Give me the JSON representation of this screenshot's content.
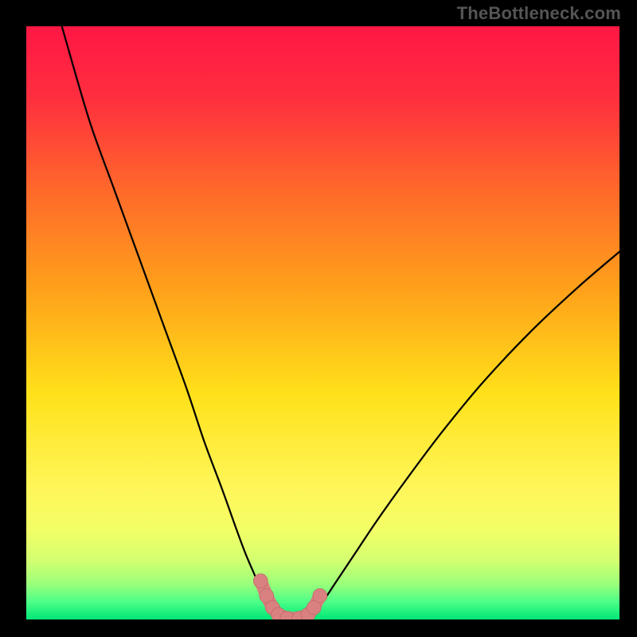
{
  "attribution": "TheBottleneck.com",
  "colors": {
    "frame": "#000000",
    "gradient_stops": [
      {
        "offset": 0.0,
        "color": "#ff1744"
      },
      {
        "offset": 0.12,
        "color": "#ff2e3f"
      },
      {
        "offset": 0.28,
        "color": "#ff6a2a"
      },
      {
        "offset": 0.45,
        "color": "#ffa31a"
      },
      {
        "offset": 0.62,
        "color": "#ffe11a"
      },
      {
        "offset": 0.78,
        "color": "#fff65a"
      },
      {
        "offset": 0.85,
        "color": "#f2ff66"
      },
      {
        "offset": 0.9,
        "color": "#d4ff70"
      },
      {
        "offset": 0.94,
        "color": "#9bff7a"
      },
      {
        "offset": 0.97,
        "color": "#4dff88"
      },
      {
        "offset": 1.0,
        "color": "#00e676"
      }
    ],
    "curve": "#000000",
    "marker_fill": "#d98080",
    "marker_stroke": "#c06868"
  },
  "chart_data": {
    "type": "line",
    "title": "",
    "xlabel": "",
    "ylabel": "",
    "xlim": [
      0,
      1000
    ],
    "ylim": [
      0,
      1000
    ],
    "series": [
      {
        "name": "left-branch",
        "x": [
          60,
          80,
          110,
          150,
          190,
          230,
          270,
          300,
          330,
          355,
          370,
          385,
          395,
          405,
          415
        ],
        "y": [
          1000,
          930,
          830,
          720,
          610,
          500,
          390,
          300,
          220,
          150,
          110,
          75,
          50,
          30,
          10
        ]
      },
      {
        "name": "valley-floor",
        "x": [
          415,
          430,
          450,
          470,
          485
        ],
        "y": [
          10,
          3,
          0,
          3,
          10
        ]
      },
      {
        "name": "right-branch",
        "x": [
          485,
          500,
          520,
          550,
          590,
          640,
          700,
          770,
          850,
          930,
          1000
        ],
        "y": [
          10,
          30,
          60,
          105,
          165,
          235,
          315,
          400,
          485,
          560,
          620
        ]
      }
    ],
    "markers": {
      "name": "highlight-segment",
      "x": [
        395,
        405,
        415,
        425,
        440,
        460,
        475,
        485,
        495
      ],
      "y": [
        65,
        40,
        20,
        8,
        2,
        2,
        8,
        20,
        40
      ],
      "r": [
        12,
        12,
        12,
        12,
        12,
        12,
        12,
        12,
        12
      ]
    }
  }
}
